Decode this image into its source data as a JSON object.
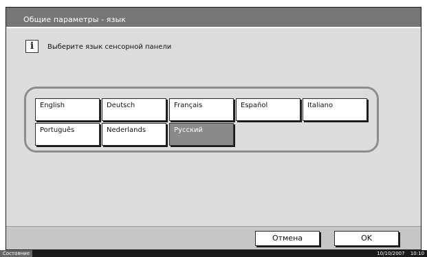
{
  "header": {
    "title": "Общие параметры - язык"
  },
  "info": {
    "icon": "info-icon",
    "glyph": "i",
    "message": "Выберите язык сенсорной панели"
  },
  "languages": [
    {
      "label": "English"
    },
    {
      "label": "Deutsch"
    },
    {
      "label": "Français"
    },
    {
      "label": "Español"
    },
    {
      "label": "Italiano"
    },
    {
      "label": "Português"
    },
    {
      "label": "Nederlands"
    },
    {
      "label": "Русский",
      "selected": true
    }
  ],
  "actions": {
    "cancel_label": "Отмена",
    "ok_label": "OK"
  },
  "status": {
    "label": "Состояние",
    "date": "10/10/2007",
    "time": "10:10"
  },
  "colors": {
    "title_bar": "#767676",
    "panel": "#dcdcdc",
    "selected_button": "#8a8a8a",
    "status_bar": "#1a1a1a"
  }
}
